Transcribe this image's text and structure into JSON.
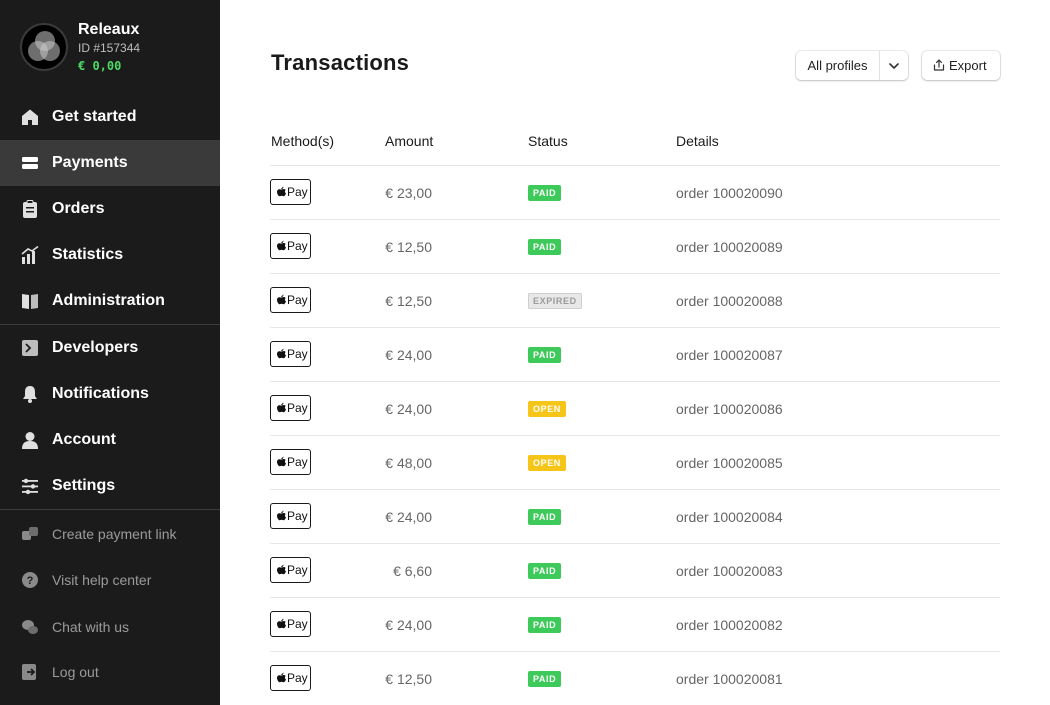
{
  "account": {
    "name": "Releaux",
    "id": "ID #157344",
    "balance": "€ 0,00"
  },
  "nav": {
    "items": [
      {
        "label": "Get started",
        "icon": "home-icon"
      },
      {
        "label": "Payments",
        "icon": "payments-icon",
        "active": true
      },
      {
        "label": "Orders",
        "icon": "clipboard-icon"
      },
      {
        "label": "Statistics",
        "icon": "chart-icon"
      },
      {
        "label": "Administration",
        "icon": "book-icon"
      },
      {
        "label": "Developers",
        "icon": "terminal-icon"
      },
      {
        "label": "Notifications",
        "icon": "bell-icon"
      },
      {
        "label": "Account",
        "icon": "user-icon"
      },
      {
        "label": "Settings",
        "icon": "sliders-icon"
      }
    ],
    "secondary": [
      {
        "label": "Create payment link",
        "icon": "link-icon"
      },
      {
        "label": "Visit help center",
        "icon": "help-icon"
      },
      {
        "label": "Chat with us",
        "icon": "chat-icon"
      },
      {
        "label": "Log out",
        "icon": "logout-icon"
      }
    ]
  },
  "page": {
    "title": "Transactions",
    "profile_filter": "All profiles",
    "export_label": "Export"
  },
  "table": {
    "headers": [
      "Method(s)",
      "Amount",
      "Status",
      "Details"
    ],
    "method_label": "Pay",
    "rows": [
      {
        "amount": "€ 23,00",
        "status": "PAID",
        "details": "order 100020090"
      },
      {
        "amount": "€ 12,50",
        "status": "PAID",
        "details": "order 100020089"
      },
      {
        "amount": "€ 12,50",
        "status": "EXPIRED",
        "details": "order 100020088"
      },
      {
        "amount": "€ 24,00",
        "status": "PAID",
        "details": "order 100020087"
      },
      {
        "amount": "€ 24,00",
        "status": "OPEN",
        "details": "order 100020086"
      },
      {
        "amount": "€ 48,00",
        "status": "OPEN",
        "details": "order 100020085"
      },
      {
        "amount": "€ 24,00",
        "status": "PAID",
        "details": "order 100020084"
      },
      {
        "amount": "€ 6,60",
        "status": "PAID",
        "details": "order 100020083"
      },
      {
        "amount": "€ 24,00",
        "status": "PAID",
        "details": "order 100020082"
      },
      {
        "amount": "€ 12,50",
        "status": "PAID",
        "details": "order 100020081"
      }
    ]
  },
  "colors": {
    "sidebar_bg": "#1b1b1b",
    "active_bg": "#3a3a3a",
    "paid": "#3ec95b",
    "open": "#f5c518",
    "expired_bg": "#e8e8e8",
    "expired_text": "#9a9a9a",
    "balance": "#4cd964"
  }
}
